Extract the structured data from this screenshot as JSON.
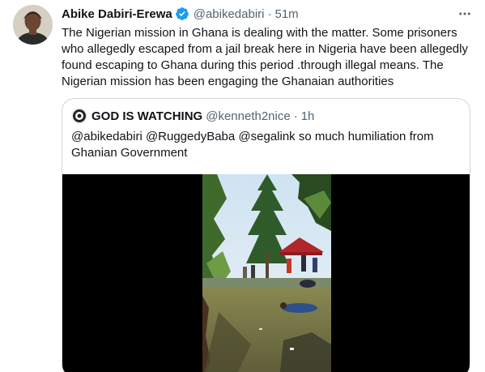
{
  "tweet": {
    "author_name": "Abike Dabiri-Erewa",
    "handle": "@abikedabiri",
    "separator": "·",
    "time": "51m",
    "text": "The Nigerian mission in Ghana is dealing with the matter. Some prisoners who allegedly escaped from a jail break here in Nigeria have been allegedly found escaping to Ghana during this period .through illegal means. The Nigerian mission has been engaging the Ghanaian authorities",
    "icons": {
      "avatar": "profile-photo",
      "verified": "verified-badge-icon",
      "more": "more-options-icon"
    }
  },
  "quoted": {
    "author_name": "GOD IS WATCHING",
    "handle": "@kenneth2nice",
    "separator": "·",
    "time": "1h",
    "text": "@abikedabiri  @RuggedyBaba @segalink so much humiliation from Ghanian Government",
    "media": {
      "type": "video",
      "description_icon": "video-thumbnail"
    }
  },
  "colors": {
    "accent": "#1d9bf0",
    "secondary_text": "#536471",
    "border": "#cfd9de",
    "primary_text": "#0f1419"
  }
}
